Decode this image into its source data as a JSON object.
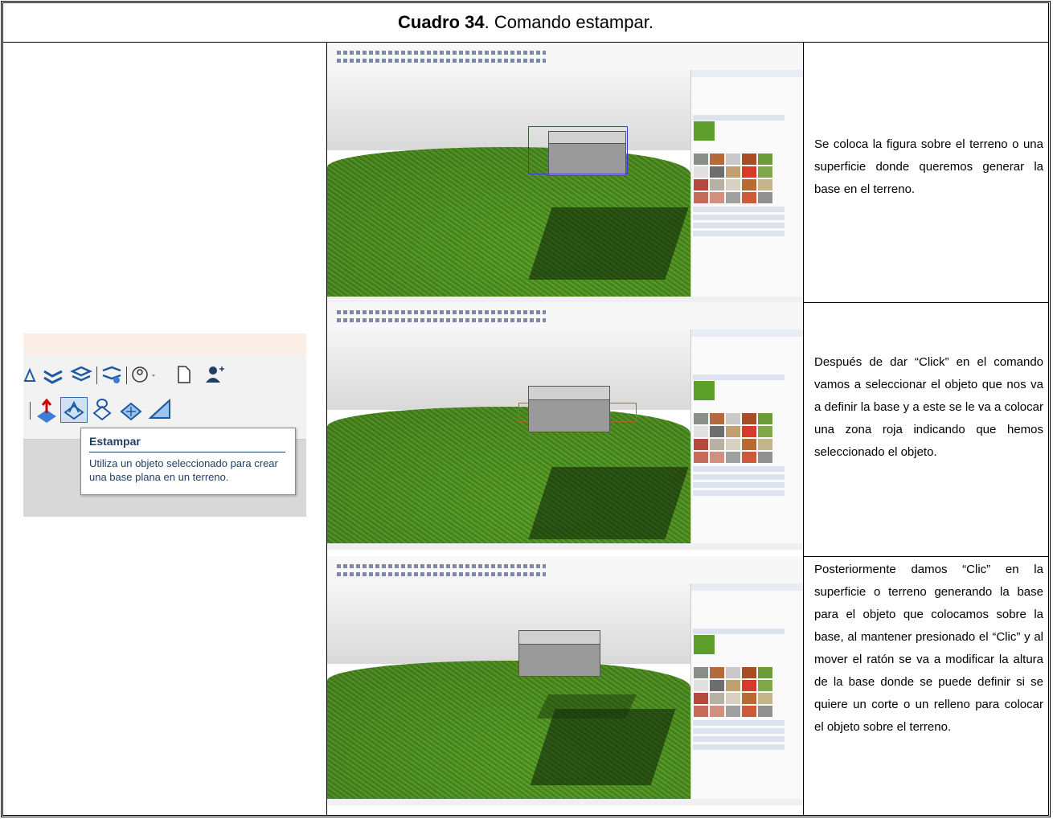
{
  "title": {
    "label": "Cuadro 34",
    "text": ". Comando estampar."
  },
  "tooltip": {
    "title": "Estampar",
    "description": "Utiliza un objeto seleccionado para crear una base plana en un terreno."
  },
  "rows": [
    {
      "description": "Se coloca la figura sobre el terreno o una superficie donde queremos generar la base en el terreno."
    },
    {
      "description": "Después de dar “Click” en el comando vamos a seleccionar el objeto que nos va a definir la base y a este se le va a colocar una zona roja indicando que hemos seleccionado el objeto."
    },
    {
      "description": "Posteriormente damos “Clic” en la superficie o terreno generando la base para el objeto que colocamos sobre la base, al mantener presionado el “Clic” y al mover el ratón se va a modificar la altura de la base donde se puede definir si se quiere un corte o un relleno para colocar el objeto sobre el terreno."
    }
  ],
  "colors": {
    "tooltip_text": "#1f3f66",
    "grass": "#4f8f22",
    "selection": "#3b3bd6",
    "stamp_zone": "#b5651d"
  },
  "icons": [
    "sandbox-smoove-icon",
    "sandbox-flip-edge-icon",
    "account-icon",
    "new-file-icon",
    "add-user-icon",
    "stamp-icon",
    "drape-icon",
    "add-detail-icon"
  ]
}
